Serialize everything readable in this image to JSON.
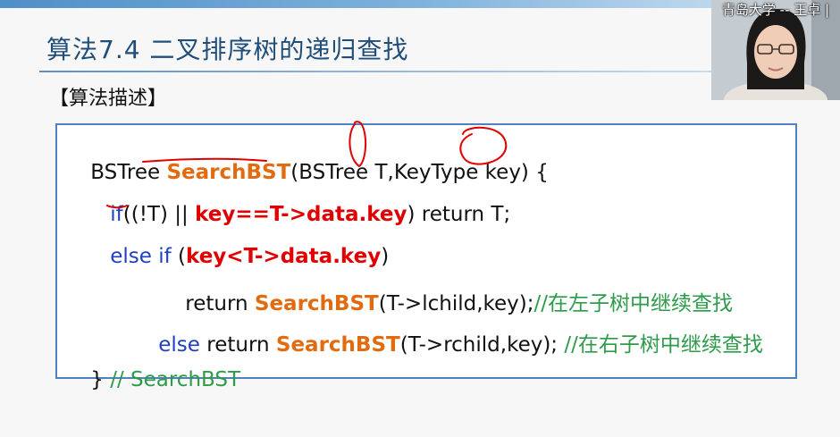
{
  "slide": {
    "title": "算法7.4  二叉排序树的递归查找",
    "section_label": "【算法描述】"
  },
  "code": {
    "line1": {
      "t1": "BSTree ",
      "t2": "SearchBST",
      "t3": "(BSTree T,KeyType key) {"
    },
    "line2": {
      "t1": "if",
      "t2": "((!T) || ",
      "t3": "key==T->data.key",
      "t4": ") return T;"
    },
    "line3": {
      "t1": "else if ",
      "t2": "(",
      "t3": "key<T->data.key",
      "t4": ")"
    },
    "line4": {
      "t1": "return ",
      "t2": "SearchBST",
      "t3": "(T->lchild,key);",
      "t4": "//在左子树中继续查找"
    },
    "line5": {
      "t1": "else ",
      "t2": "return ",
      "t3": "SearchBST",
      "t4": "(T->rchild,key); ",
      "t5": "//在右子树中继续查找"
    },
    "line6": {
      "t1": "} ",
      "t2": "// SearchBST"
    }
  },
  "webcam": {
    "caption": "青岛大学 -- 王卓 |"
  },
  "colors": {
    "title": "#1f4e79",
    "keyword": "#1f3fbf",
    "function": "#e26b10",
    "expression": "#e00000",
    "comment": "#2e9b4a",
    "annotation": "#e00000",
    "border": "#4f81bd"
  }
}
